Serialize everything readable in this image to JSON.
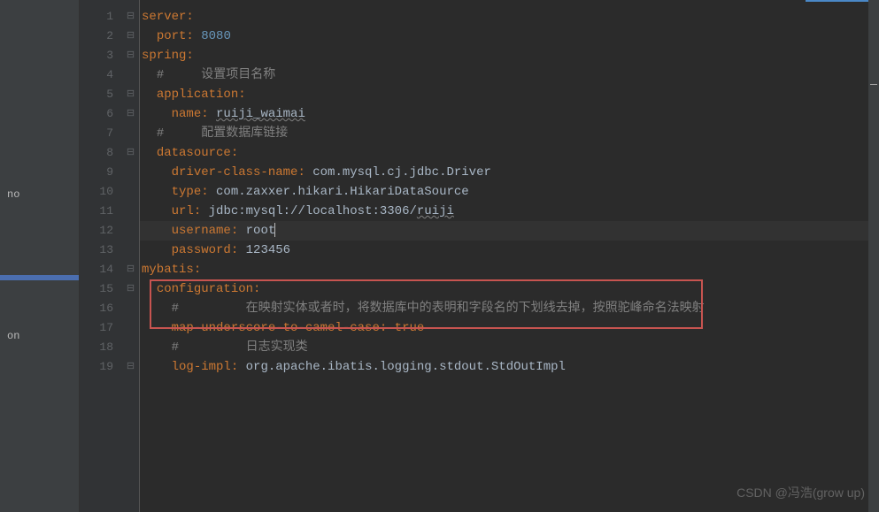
{
  "sidebar": {
    "item1": "no",
    "item2": "",
    "item3": "on"
  },
  "editor": {
    "lines": {
      "1": {
        "num": "1",
        "indent": "",
        "key": "server",
        "after": ":"
      },
      "2": {
        "num": "2",
        "indent": "  ",
        "key": "port",
        "after": ": ",
        "val": "8080",
        "valtype": "num"
      },
      "3": {
        "num": "3",
        "indent": "",
        "key": "spring",
        "after": ":"
      },
      "4": {
        "num": "4",
        "indent": "  ",
        "comment": "#     设置项目名称"
      },
      "5": {
        "num": "5",
        "indent": "  ",
        "key": "application",
        "after": ":"
      },
      "6": {
        "num": "6",
        "indent": "    ",
        "key": "name",
        "after": ": ",
        "val": "ruiji_waimai",
        "valtype": "ul"
      },
      "7": {
        "num": "7",
        "indent": "  ",
        "comment": "#     配置数据库链接"
      },
      "8": {
        "num": "8",
        "indent": "  ",
        "key": "datasource",
        "after": ":"
      },
      "9": {
        "num": "9",
        "indent": "    ",
        "key": "driver-class-name",
        "after": ": ",
        "val": "com.mysql.cj.jdbc.Driver"
      },
      "10": {
        "num": "10",
        "indent": "    ",
        "key": "type",
        "after": ": ",
        "val": "com.zaxxer.hikari.HikariDataSource"
      },
      "11": {
        "num": "11",
        "indent": "    ",
        "key": "url",
        "after": ": ",
        "val": "jdbc:mysql://localhost:3306/",
        "val2": "ruiji"
      },
      "12": {
        "num": "12",
        "indent": "    ",
        "key": "username",
        "after": ": ",
        "val": "root"
      },
      "13": {
        "num": "13",
        "indent": "    ",
        "key": "password",
        "after": ": ",
        "val": "123456"
      },
      "14": {
        "num": "14",
        "indent": "",
        "key": "mybatis",
        "after": ":"
      },
      "15": {
        "num": "15",
        "indent": "  ",
        "key": "configuration",
        "after": ":"
      },
      "16": {
        "num": "16",
        "indent": "    ",
        "comment": "#         在映射实体或者时，将数据库中的表明和字段名的下划线去掉，按照驼峰命名法映射"
      },
      "17": {
        "num": "17",
        "indent": "    ",
        "key": "map-underscore-to-camel-case",
        "after": ": ",
        "val": "true",
        "valtype": "bool"
      },
      "18": {
        "num": "18",
        "indent": "    ",
        "comment": "#         日志实现类"
      },
      "19": {
        "num": "19",
        "indent": "    ",
        "key": "log-impl",
        "after": ": ",
        "val": "org.apache.ibatis.logging.stdout.StdOutImpl"
      }
    },
    "activeLine": "12",
    "foldMarks": [
      "1",
      "2",
      "3",
      "5",
      "6",
      "8",
      "14",
      "15",
      "19"
    ]
  },
  "watermark": "CSDN @冯浩(grow up)"
}
